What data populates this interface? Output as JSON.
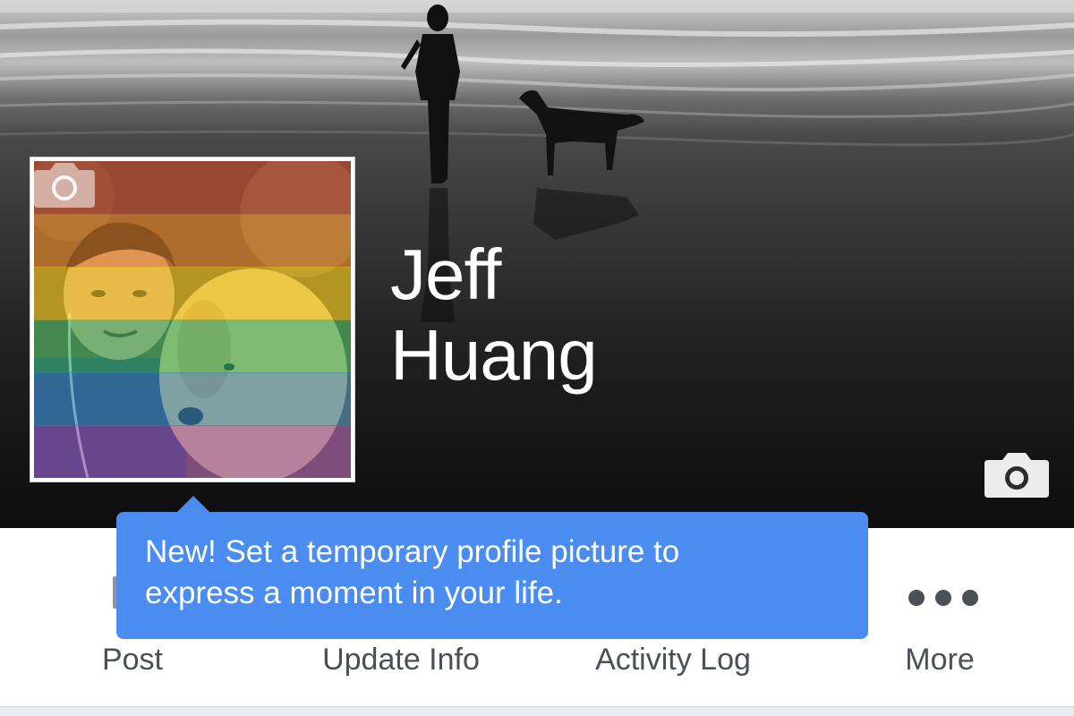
{
  "profile": {
    "first_name": "Jeff",
    "last_name": "Huang",
    "rainbow_colors": [
      "#c0392b",
      "#e67e22",
      "#f1c40f",
      "#27ae60",
      "#2980b9",
      "#8e44ad"
    ]
  },
  "tooltip": {
    "line1": "New! Set a temporary profile picture to",
    "line2": "express a moment in your life.",
    "color": "#4a8cf0"
  },
  "actions": [
    {
      "label": "Post",
      "icon": "pencil-icon"
    },
    {
      "label": "Update Info",
      "icon": "info-icon"
    },
    {
      "label": "Activity Log",
      "icon": "list-icon"
    },
    {
      "label": "More",
      "icon": "more-dots-icon"
    }
  ],
  "icons": {
    "cover_camera": "camera-icon",
    "profile_camera": "camera-icon"
  }
}
